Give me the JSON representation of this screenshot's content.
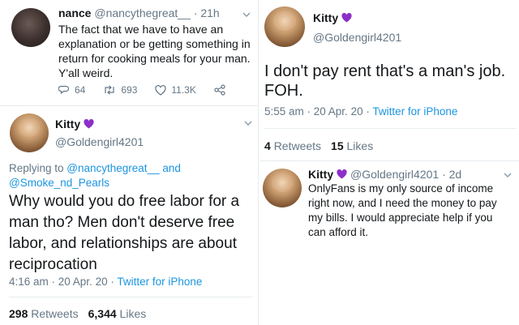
{
  "colors": {
    "accent": "#1b95e0",
    "heart": "#8b2fc9",
    "text": "#14171a",
    "muted": "#657786"
  },
  "tweet1": {
    "name": "nance",
    "handle": "@nancythegreat__",
    "time": "· 21h",
    "lines": [
      "The fact that we have to have an",
      "explanation or be getting something in",
      "return for cooking meals for your man.",
      "Y'all weird."
    ],
    "replies": "64",
    "retweets": "693",
    "likes": "11.3K"
  },
  "tweet2": {
    "name": "Kitty",
    "heart_icon": "purple-heart-icon",
    "handle": "@Goldengirl4201",
    "replying_prefix": "Replying to ",
    "replying_user1": "@nancythegreat__",
    "replying_and": " and",
    "replying_user2": "@Smoke_nd_Pearls",
    "lines": [
      "Why would you do free labor for a",
      "man tho? Men don't deserve free",
      "labor, and relationships are about",
      "reciprocation"
    ],
    "time": "4:16 am · 20 Apr. 20 · ",
    "client": "Twitter for iPhone",
    "retweets_count": "298",
    "retweets_label": "Retweets",
    "likes_count": "6,344",
    "likes_label": "Likes"
  },
  "tweet3": {
    "name": "Kitty",
    "heart_icon": "purple-heart-icon",
    "handle": "@Goldengirl4201",
    "lines": [
      "I don't pay rent that's a man's job.",
      "FOH."
    ],
    "time": "5:55 am · 20 Apr. 20 · ",
    "client": "Twitter for iPhone",
    "retweets_count": "4",
    "retweets_label": "Retweets",
    "likes_count": "15",
    "likes_label": "Likes"
  },
  "tweet4": {
    "name": "Kitty",
    "heart_icon": "purple-heart-icon",
    "handle": "@Goldengirl4201",
    "time": "· 2d",
    "lines": [
      "OnlyFans is my only source of income",
      "right now, and I need the money to pay",
      "my bills. I would appreciate help if you",
      "can afford it."
    ]
  }
}
